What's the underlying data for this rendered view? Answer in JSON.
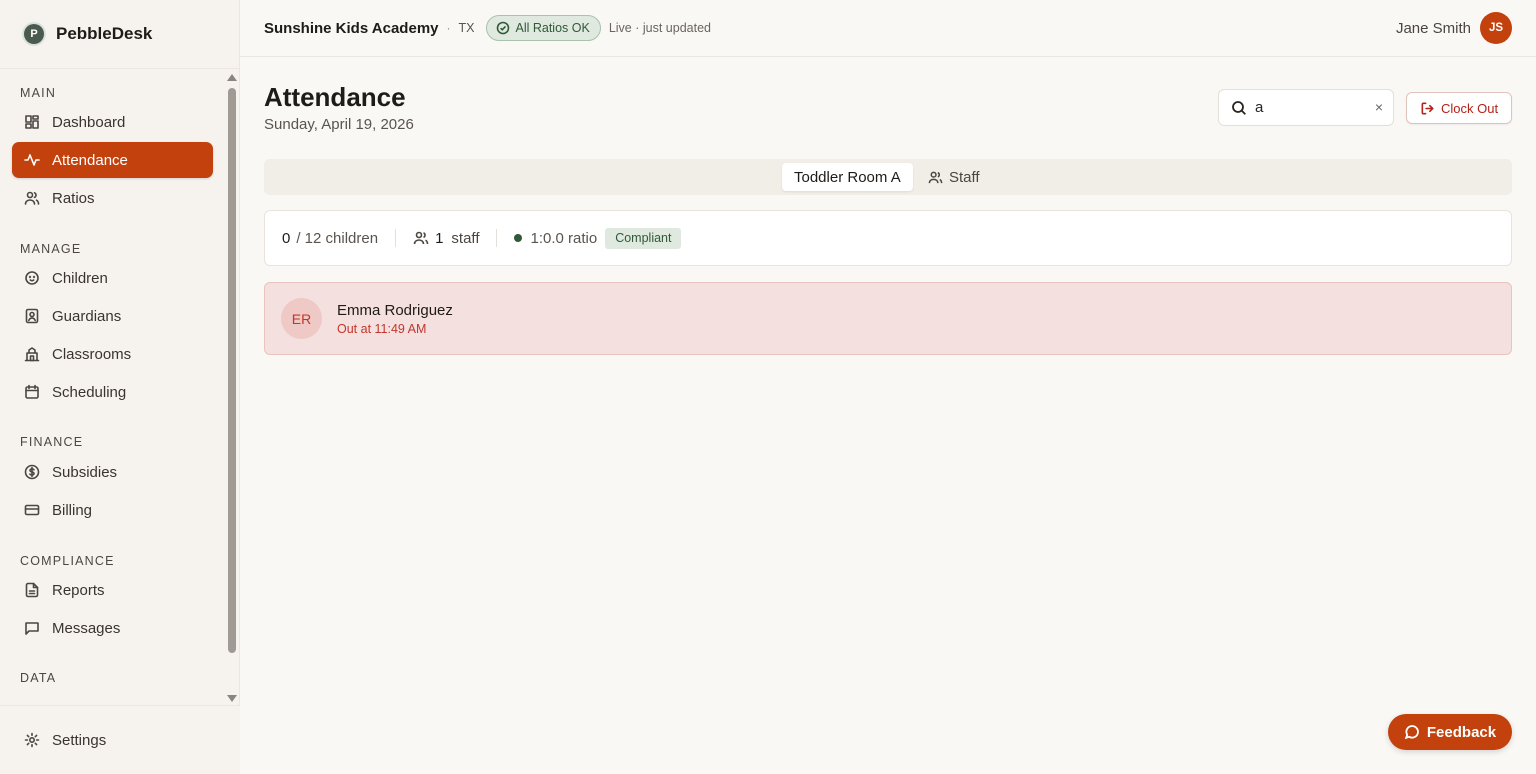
{
  "brand": {
    "name": "PebbleDesk",
    "logo_letter": "P"
  },
  "sidebar": {
    "sections": [
      {
        "label": "MAIN"
      },
      {
        "label": "MANAGE"
      },
      {
        "label": "FINANCE"
      },
      {
        "label": "COMPLIANCE"
      },
      {
        "label": "DATA"
      }
    ],
    "items": [
      {
        "label": "Dashboard",
        "icon": "dashboard-icon"
      },
      {
        "label": "Attendance",
        "icon": "activity-icon",
        "active": true
      },
      {
        "label": "Ratios",
        "icon": "users-icon"
      },
      {
        "label": "Children",
        "icon": "baby-icon"
      },
      {
        "label": "Guardians",
        "icon": "guardian-icon"
      },
      {
        "label": "Classrooms",
        "icon": "school-icon"
      },
      {
        "label": "Scheduling",
        "icon": "calendar-icon"
      },
      {
        "label": "Subsidies",
        "icon": "dollar-icon"
      },
      {
        "label": "Billing",
        "icon": "credit-card-icon"
      },
      {
        "label": "Reports",
        "icon": "report-icon"
      },
      {
        "label": "Messages",
        "icon": "message-icon"
      }
    ],
    "settings_label": "Settings"
  },
  "header": {
    "org_name": "Sunshine Kids Academy",
    "separator": "·",
    "state": "TX",
    "ratio_status": "All Ratios OK",
    "live_text": "Live · just updated",
    "user_name": "Jane Smith",
    "user_initials": "JS"
  },
  "page": {
    "title": "Attendance",
    "date": "Sunday, April 19, 2026"
  },
  "search": {
    "value": "a",
    "clear": "×"
  },
  "clock_out_label": "Clock Out",
  "tabs": [
    {
      "label": "Toddler Room A",
      "active": true
    },
    {
      "label": "Staff",
      "active": false
    }
  ],
  "summary": {
    "children_present": "0",
    "children_total": "/ 12 children",
    "staff_count": "1",
    "staff_label": "staff",
    "ratio": "1:0.0 ratio",
    "status": "Compliant"
  },
  "children": [
    {
      "initials": "ER",
      "name": "Emma Rodriguez",
      "status": "Out at 11:49 AM"
    }
  ],
  "feedback_label": "Feedback",
  "colors": {
    "accent": "#c2410c",
    "success": "#2f5a37",
    "danger": "#c2362b"
  }
}
